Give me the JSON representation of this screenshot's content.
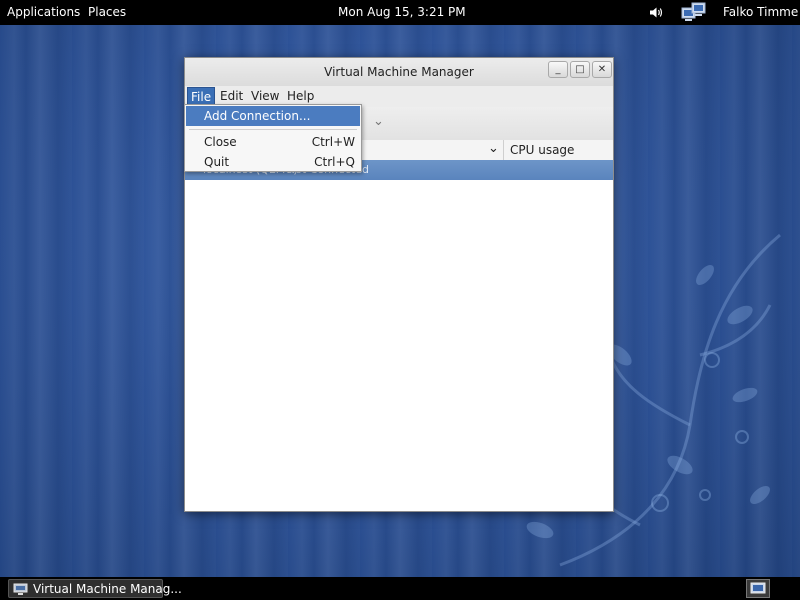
{
  "top_panel": {
    "applications": "Applications",
    "places": "Places",
    "clock": "Mon Aug 15,  3:21 PM",
    "user": "Falko Timme",
    "volume_icon": "volume-icon",
    "network_icon": "network-icon"
  },
  "window": {
    "title": "Virtual Machine Manager",
    "minimize_symbol": "_",
    "maximize_symbol": "□",
    "close_symbol": "✕",
    "menu": [
      "File",
      "Edit",
      "View",
      "Help"
    ],
    "toolbar_dropdown_symbol": "⌄",
    "column_dropdown_symbol": "⌄",
    "column_header": "CPU usage",
    "selected_row": {
      "name": "localhost (QEMU)",
      "status": "Not Connected"
    }
  },
  "file_menu": {
    "items": [
      {
        "label": "Add Connection...",
        "accel": ""
      },
      {
        "label": "Close",
        "accel": "Ctrl+W"
      },
      {
        "label": "Quit",
        "accel": "Ctrl+Q"
      }
    ]
  },
  "taskbar": {
    "task_label": "Virtual Machine Manag..."
  },
  "colors": {
    "desktop": "#2d5297",
    "panel": "#000000",
    "menu_highlight": "#4b7cc0",
    "selection": "#5a84bd"
  }
}
